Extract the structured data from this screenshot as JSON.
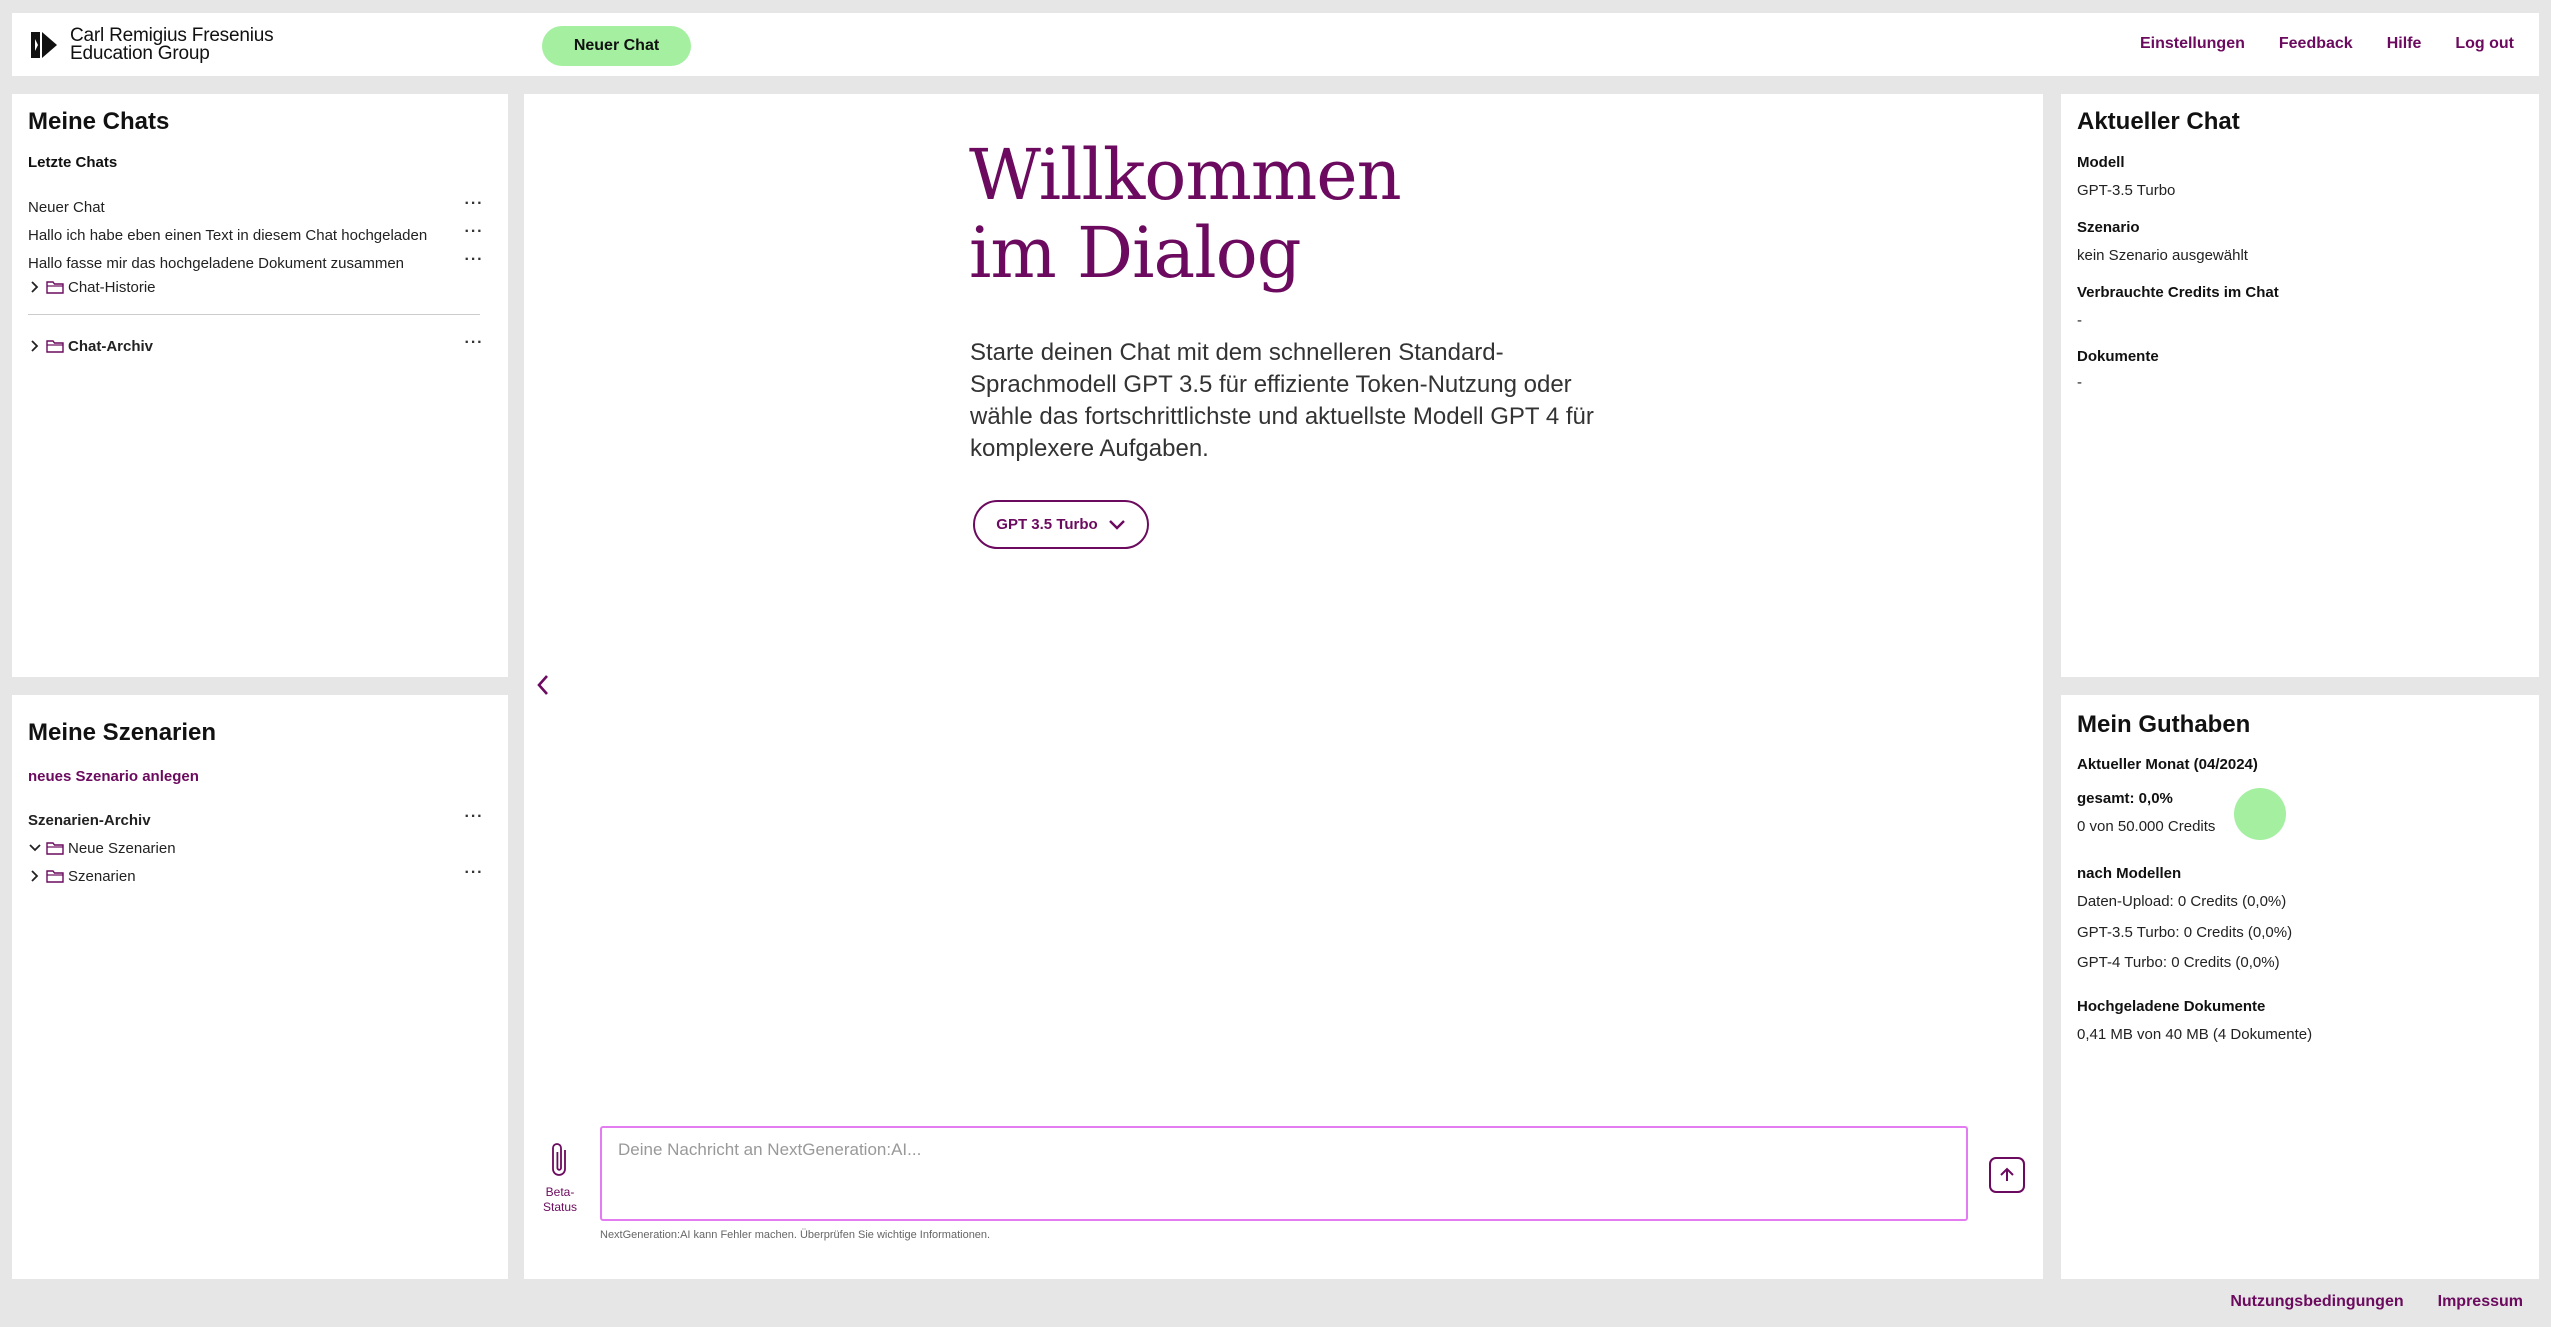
{
  "header": {
    "logo_line1": "Carl Remigius Fresenius",
    "logo_line2": "Education Group",
    "new_chat": "Neuer Chat",
    "nav": [
      "Einstellungen",
      "Feedback",
      "Hilfe",
      "Log out"
    ]
  },
  "chats": {
    "title": "Meine Chats",
    "recent_title": "Letzte Chats",
    "items": [
      "Neuer Chat",
      "Hallo ich habe eben einen Text in diesem Chat hochgeladen",
      "Hallo fasse mir das hochgeladene Dokument zusammen"
    ],
    "history_folder": "Chat-Historie",
    "archive_folder": "Chat-Archiv"
  },
  "scenarios": {
    "title": "Meine Szenarien",
    "new_link": "neues Szenario anlegen",
    "archive_title": "Szenarien-Archiv",
    "folders": [
      "Neue Szenarien",
      "Szenarien"
    ]
  },
  "main": {
    "welcome_line1": "Willkommen",
    "welcome_line2": "im Dialog",
    "intro": "Starte deinen Chat mit dem schnelleren Standard-Sprachmodell GPT 3.5 für effiziente Token-Nutzung oder wähle das fortschrittlichste und aktuellste Modell GPT 4 für komplexere Aufgaben.",
    "model_selected": "GPT 3.5 Turbo",
    "input_placeholder": "Deine Nachricht an NextGeneration:AI...",
    "beta_line1": "Beta-",
    "beta_line2": "Status",
    "disclaimer": "NextGeneration:AI kann Fehler machen. Überprüfen Sie wichtige Informationen."
  },
  "current_chat": {
    "title": "Aktueller Chat",
    "model_label": "Modell",
    "model_value": "GPT-3.5 Turbo",
    "scenario_label": "Szenario",
    "scenario_value": "kein Szenario ausgewählt",
    "credits_label": "Verbrauchte Credits im Chat",
    "credits_value": "-",
    "docs_label": "Dokumente",
    "docs_value": "-"
  },
  "credits": {
    "title": "Mein Guthaben",
    "month_label": "Aktueller Monat (04/2024)",
    "total_label": "gesamt: 0,0%",
    "total_value": "0 von 50.000 Credits",
    "total_fraction": 0.0,
    "by_model_label": "nach Modellen",
    "by_model": [
      "Daten-Upload: 0 Credits (0,0%)",
      "GPT-3.5 Turbo: 0 Credits (0,0%)",
      "GPT-4 Turbo: 0 Credits (0,0%)"
    ],
    "uploads_label": "Hochgeladene Dokumente",
    "uploads_value": "0,41 MB von 40 MB (4 Dokumente)"
  },
  "footer": {
    "links": [
      "Nutzungsbedingungen",
      "Impressum"
    ]
  },
  "colors": {
    "brand": "#6b0a5e",
    "accent_green": "#a4efa0",
    "input_border": "#e37cf0",
    "background": "#e5e6e5"
  }
}
